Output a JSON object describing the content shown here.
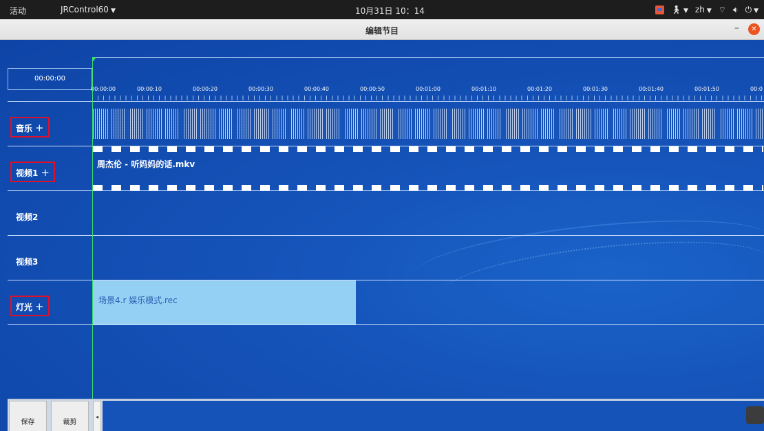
{
  "topbar": {
    "activities": "活动",
    "app_menu": "JRControl60",
    "clock": "10月31日 10：14",
    "lang": "zh"
  },
  "window": {
    "title": "编辑节目"
  },
  "timeline": {
    "current_time": "00:00:00",
    "ticks": [
      "00:00:00",
      "00:00:10",
      "00:00:20",
      "00:00:30",
      "00:00:40",
      "00:00:50",
      "00:01:00",
      "00:01:10",
      "00:01:20",
      "00:01:30",
      "00:01:40",
      "00:01:50",
      "00:0"
    ]
  },
  "tracks": {
    "music": {
      "label": "音乐",
      "add": "+"
    },
    "video1": {
      "label": "视频1",
      "add": "+",
      "clip": "周杰伦 - 听妈妈的话.mkv"
    },
    "video2": {
      "label": "视频2"
    },
    "video3": {
      "label": "视频3"
    },
    "light": {
      "label": "灯光",
      "add": "+",
      "clip": "场景4.r  娱乐模式.rec"
    }
  },
  "footer": {
    "save": "保存",
    "cut": "裁剪",
    "scroll_left": "◂"
  },
  "colors": {
    "background": "#1553b9",
    "light_clip": "#93d0f3",
    "highlight_box": "#e0102a",
    "playhead": "#3ee06a"
  }
}
